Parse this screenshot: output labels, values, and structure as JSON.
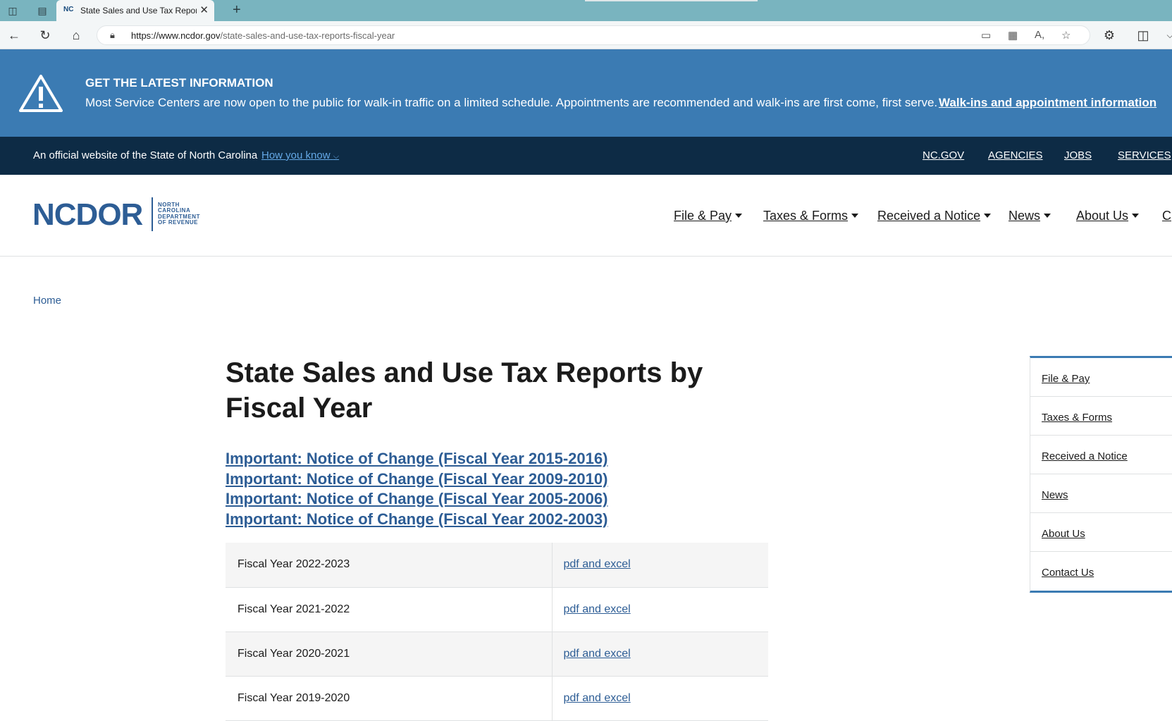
{
  "browser": {
    "tab_favicon": "NC",
    "tab_title": "State Sales and Use Tax Reports by Fiscal Year",
    "url_domain": "https://www.ncdor.gov",
    "url_path": "/state-sales-and-use-tax-reports-fiscal-year"
  },
  "alert": {
    "title": "GET THE LATEST INFORMATION",
    "text": "Most Service Centers are now open to the public for walk-in traffic on a limited schedule. Appointments are recommended and walk-ins are first come, first serve.",
    "link": "Walk-ins and appointment information"
  },
  "official": {
    "text": "An official website of the State of North Carolina",
    "how_link": "How you know",
    "links": [
      "NC.GOV",
      "AGENCIES",
      "JOBS",
      "SERVICES"
    ]
  },
  "logo": {
    "main": "NCDOR",
    "sub": [
      "NORTH",
      "CAROLINA",
      "DEPARTMENT",
      "OF REVENUE"
    ]
  },
  "main_nav": [
    "File & Pay",
    "Taxes & Forms",
    "Received a Notice",
    "News",
    "About Us",
    "C"
  ],
  "breadcrumb": "Home",
  "page_title": "State Sales and Use Tax Reports by Fiscal Year",
  "notice_links": [
    "Important: Notice of Change (Fiscal Year 2015-2016)",
    "Important: Notice of Change (Fiscal Year 2009-2010)",
    "Important: Notice of Change (Fiscal Year 2005-2006)",
    "Important: Notice of Change (Fiscal Year 2002-2003)"
  ],
  "table": [
    {
      "year": "Fiscal Year 2022-2023",
      "link": "pdf and excel"
    },
    {
      "year": "Fiscal Year 2021-2022",
      "link": "pdf and excel"
    },
    {
      "year": "Fiscal Year 2020-2021",
      "link": "pdf and excel"
    },
    {
      "year": "Fiscal Year 2019-2020",
      "link": "pdf and excel"
    }
  ],
  "side_nav": [
    "File & Pay",
    "Taxes & Forms",
    "Received a Notice",
    "News",
    "About Us",
    "Contact Us"
  ]
}
